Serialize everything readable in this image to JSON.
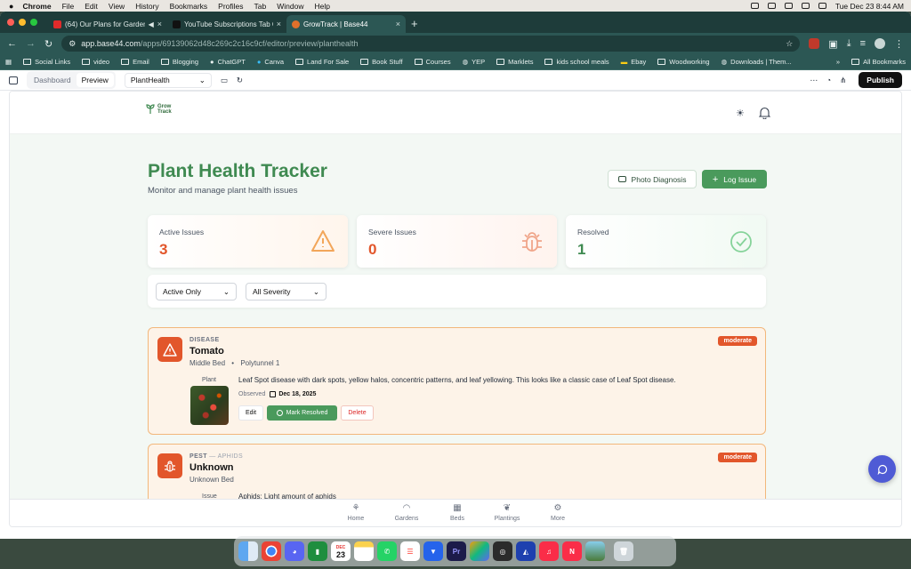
{
  "menubar": {
    "app": "Chrome",
    "items": [
      "File",
      "Edit",
      "View",
      "History",
      "Bookmarks",
      "Profiles",
      "Tab",
      "Window",
      "Help"
    ],
    "clock": "Tue Dec 23  8:44 AM"
  },
  "tabs": [
    {
      "label": "(64) Our Plans for Garden",
      "color": "#e02b2b"
    },
    {
      "label": "YouTube Subscriptions Tab C",
      "color": "#111111"
    },
    {
      "label": "GrowTrack | Base44",
      "color": "#e0702b",
      "active": true
    }
  ],
  "url": {
    "host": "app.base44.com",
    "path": "/apps/69139062d48c269c2c16c9cf/editor/preview/planthealth"
  },
  "bookmarks": [
    "Social Links",
    "video",
    "Email",
    "Blogging",
    "ChatGPT",
    "Canva",
    "Land For Sale",
    "Book Stuff",
    "Courses",
    "YEP",
    "Marklets",
    "kids school meals",
    "Ebay",
    "Woodworking",
    "Downloads | Them..."
  ],
  "all_bookmarks": "All Bookmarks",
  "editor": {
    "dashboard": "Dashboard",
    "preview": "Preview",
    "page": "PlantHealth",
    "publish": "Publish"
  },
  "app": {
    "logo_line1": "Grow",
    "logo_line2": "Track",
    "title": "Plant Health Tracker",
    "subtitle": "Monitor and manage plant health issues",
    "photo_btn": "Photo Diagnosis",
    "log_btn": "Log Issue"
  },
  "stats": [
    {
      "label": "Active Issues",
      "value": "3",
      "color": "#e2562b"
    },
    {
      "label": "Severe Issues",
      "value": "0",
      "color": "#e2562b"
    },
    {
      "label": "Resolved",
      "value": "1",
      "color": "#3f8a51"
    }
  ],
  "filters": {
    "status": "Active Only",
    "severity": "All Severity"
  },
  "issues": [
    {
      "category": "DISEASE",
      "subcategory": "",
      "name": "Tomato",
      "bed": "Middle Bed",
      "location": "Polytunnel 1",
      "severity": "moderate",
      "thumb_label": "Plant",
      "description": "Leaf Spot disease with dark spots, yellow halos, concentric patterns, and leaf yellowing. This looks like a classic case of Leaf Spot disease.",
      "observed_label": "Observed",
      "observed_date": "Dec 18, 2025",
      "edit": "Edit",
      "resolve": "Mark Resolved",
      "delete": "Delete"
    },
    {
      "category": "PEST",
      "subcategory": "— APHIDS",
      "name": "Unknown",
      "bed": "Unknown Bed",
      "severity": "moderate",
      "thumb_label": "Issue",
      "description": "Aphids: Light amount of aphids"
    }
  ],
  "nav": [
    "Home",
    "Gardens",
    "Beds",
    "Plantings",
    "More"
  ],
  "dock": [
    "Finder",
    "Chrome",
    "Discord",
    "Numbers",
    "Calendar",
    "Notes",
    "WhatsApp",
    "Reminders",
    "Vectorize",
    "Premiere",
    "Photos",
    "QuickTime",
    "Nova",
    "Music",
    "News",
    "Preview",
    "Trash"
  ],
  "dock_calendar": {
    "month": "DEC",
    "day": "23"
  }
}
